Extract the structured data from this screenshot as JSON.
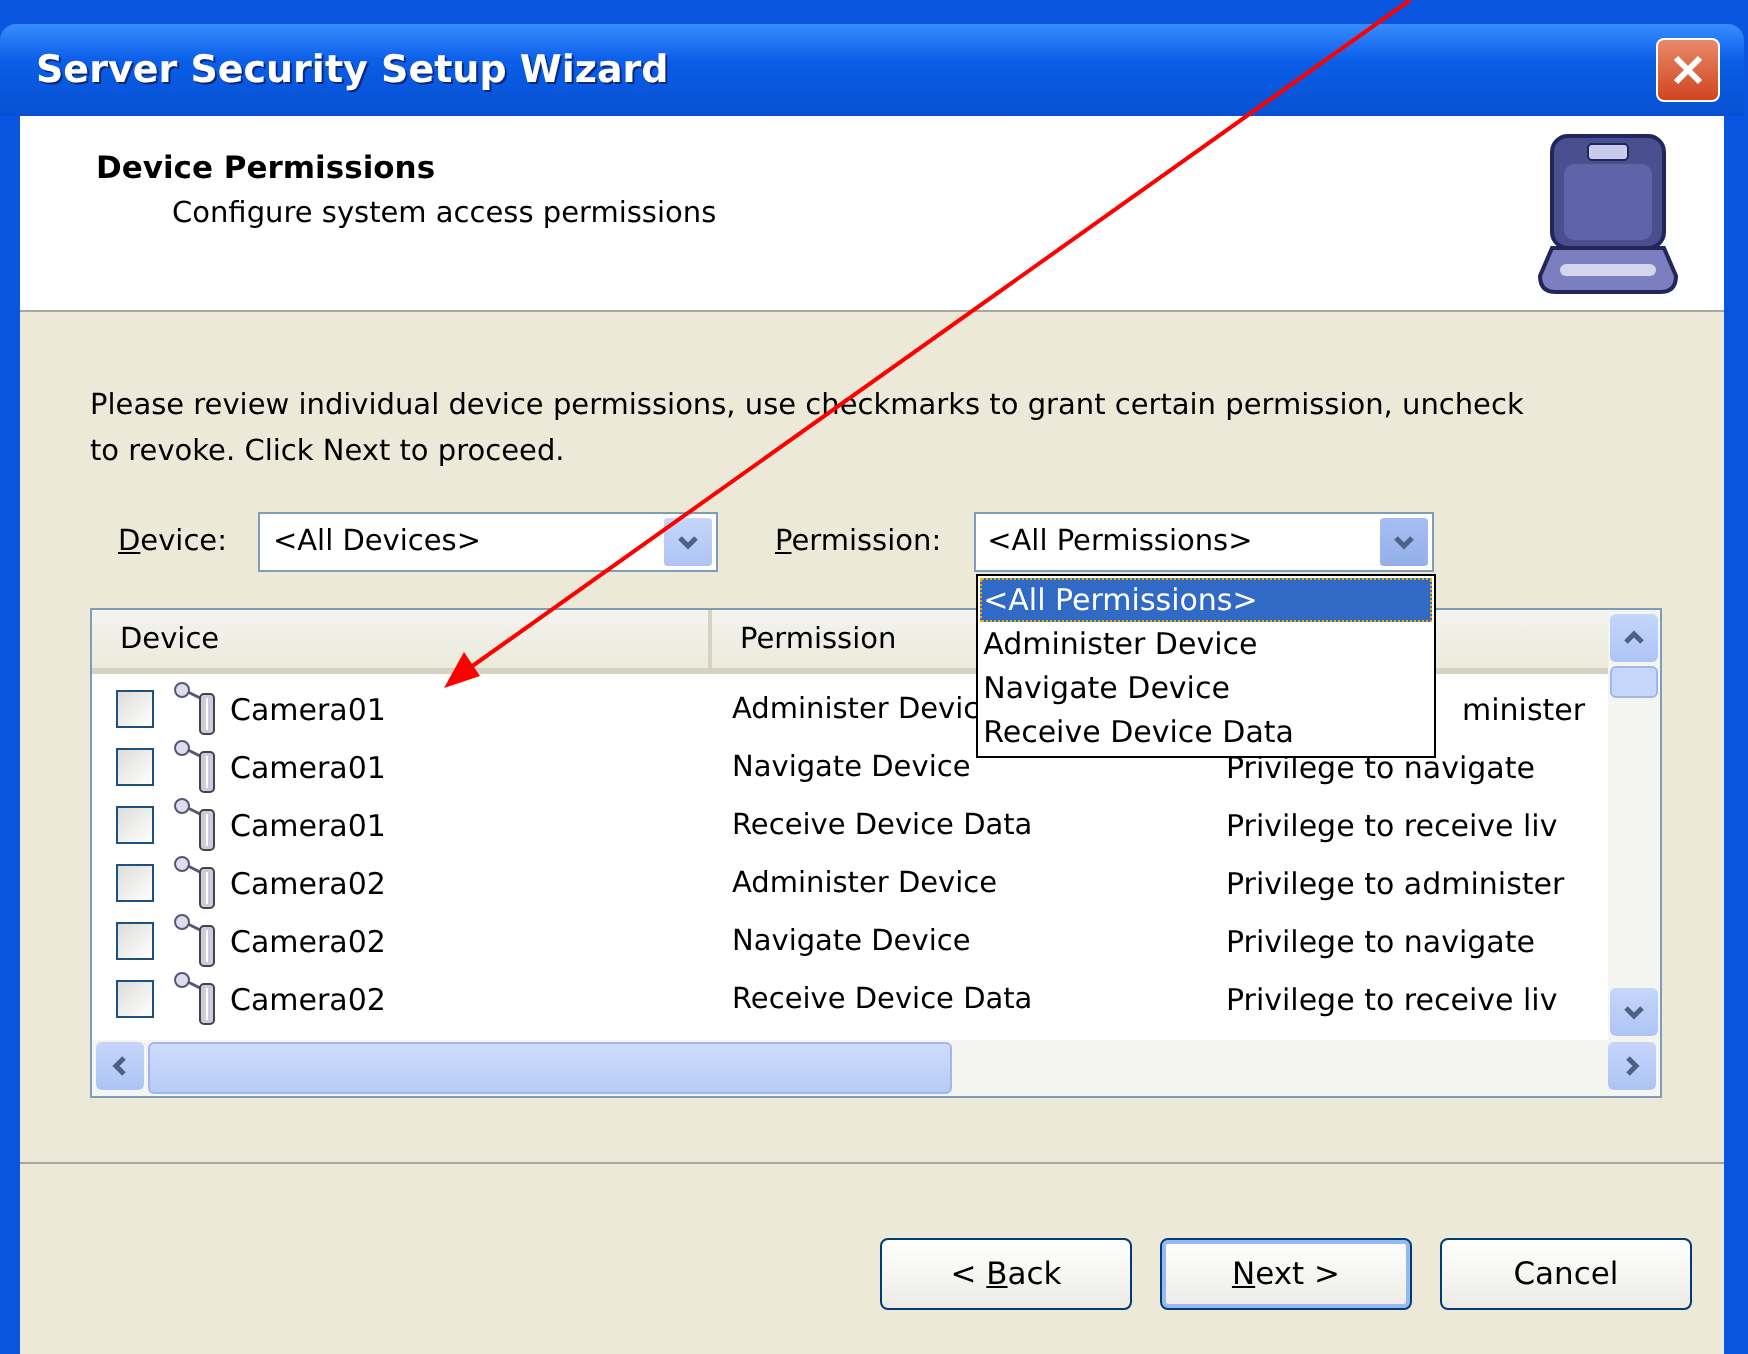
{
  "window": {
    "title": "Server Security Setup Wizard"
  },
  "header": {
    "title": "Device Permissions",
    "subtitle": "Configure system access permissions"
  },
  "instructions": "Please review individual device permissions, use checkmarks to grant certain permission, uncheck to revoke. Click Next to proceed.",
  "filters": [
    {
      "label": "D",
      "label_rest": "evice:",
      "value": "<All Devices>",
      "expanded": false
    },
    {
      "label": "P",
      "label_rest": "ermission:",
      "value": "<All Permissions>",
      "expanded": true,
      "options": [
        {
          "label": "<All Permissions>",
          "selected": true
        },
        {
          "label": "Administer Device",
          "selected": false
        },
        {
          "label": "Navigate Device",
          "selected": false
        },
        {
          "label": "Receive Device Data",
          "selected": false
        }
      ]
    }
  ],
  "table": {
    "columns": [
      "Device",
      "Permission"
    ],
    "rows": [
      {
        "checked": false,
        "device": "Camera01",
        "permission": "Administer Devic",
        "description": "minister"
      },
      {
        "checked": false,
        "device": "Camera01",
        "permission": "Navigate Device",
        "description": "Privilege to navigate"
      },
      {
        "checked": false,
        "device": "Camera01",
        "permission": "Receive Device Data",
        "description": "Privilege to receive liv"
      },
      {
        "checked": false,
        "device": "Camera02",
        "permission": "Administer Device",
        "description": "Privilege to administer"
      },
      {
        "checked": false,
        "device": "Camera02",
        "permission": "Navigate Device",
        "description": "Privilege to navigate"
      },
      {
        "checked": false,
        "device": "Camera02",
        "permission": "Receive Device Data",
        "description": "Privilege to receive liv"
      }
    ]
  },
  "buttons": [
    {
      "key": "B",
      "before": "< ",
      "rest": "ack",
      "primary": false
    },
    {
      "key": "N",
      "rest": "ext >",
      "primary": true
    },
    {
      "rest": "Cancel",
      "primary": false
    }
  ]
}
